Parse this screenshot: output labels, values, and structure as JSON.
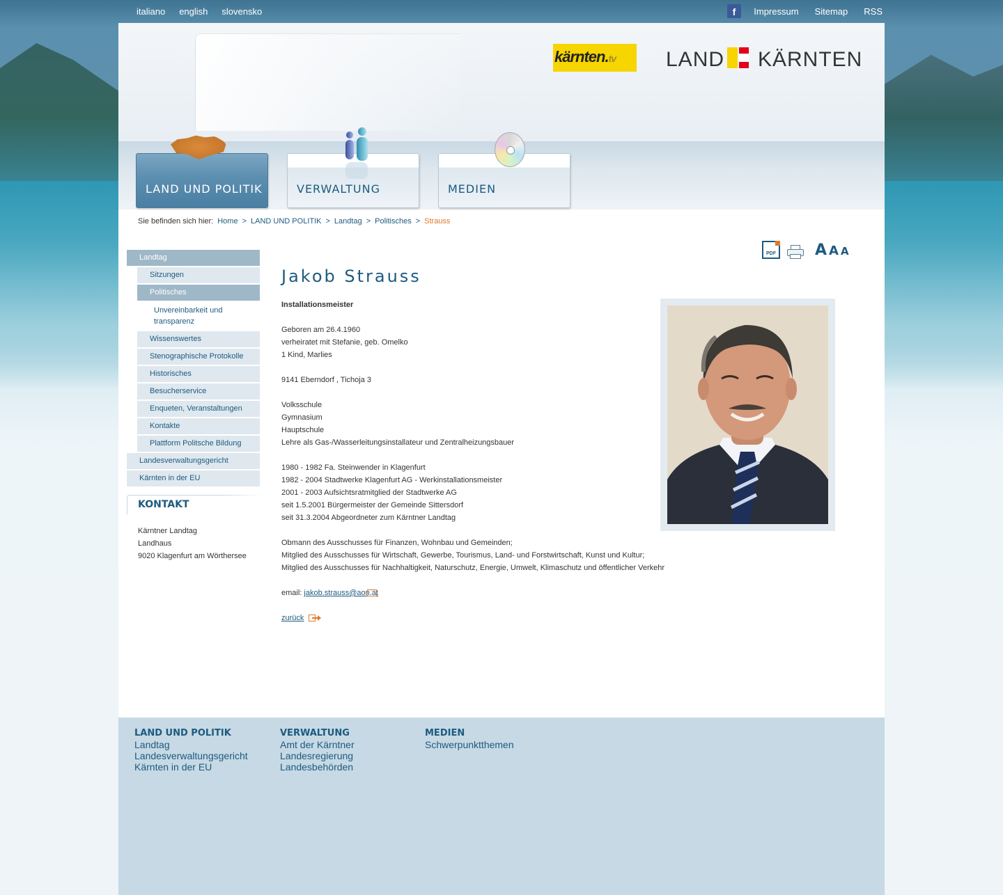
{
  "topbar": {
    "languages": [
      "italiano",
      "english",
      "slovensko"
    ],
    "links": [
      "Impressum",
      "Sitemap",
      "RSS"
    ]
  },
  "header": {
    "ktv_logo": "kärnten.",
    "ktv_logo_suffix": "tv",
    "logo_left": "LAND",
    "logo_right": "KÄRNTEN"
  },
  "nav": {
    "tabs": [
      {
        "label": "LAND UND POLITIK",
        "active": true
      },
      {
        "label": "VERWALTUNG",
        "active": false
      },
      {
        "label": "MEDIEN",
        "active": false
      }
    ]
  },
  "breadcrumb": {
    "prefix": "Sie befinden sich hier:",
    "items": [
      "Home",
      "LAND UND POLITIK",
      "Landtag",
      "Politisches"
    ],
    "current": "Strauss",
    "separator": ">"
  },
  "sidebar": {
    "items": [
      {
        "label": "Landtag"
      },
      {
        "label": "Sitzungen"
      },
      {
        "label": "Politisches"
      },
      {
        "label": "Unvereinbarkeit und transparenz"
      },
      {
        "label": "Wissenswertes"
      },
      {
        "label": "Stenographische Protokolle"
      },
      {
        "label": "Historisches"
      },
      {
        "label": "Besucherservice"
      },
      {
        "label": "Enqueten, Veranstaltungen"
      },
      {
        "label": "Kontakte"
      },
      {
        "label": "Plattform Politsche Bildung"
      },
      {
        "label": "Landesverwaltungsgericht"
      },
      {
        "label": "Kärnten in der EU"
      }
    ]
  },
  "kontakt": {
    "title": "KONTAKT",
    "lines": [
      "Kärntner Landtag",
      "Landhaus",
      "9020 Klagenfurt am Wörthersee"
    ]
  },
  "tools": {
    "pdf": "PDF",
    "font_large": "A",
    "font_medium": "A",
    "font_small": "A"
  },
  "profile": {
    "name": "Jakob Strauss",
    "job": "Installationsmeister",
    "personal": [
      "Geboren am 26.4.1960",
      "verheiratet mit Stefanie, geb. Omelko",
      "1 Kind, Marlies"
    ],
    "address": "9141 Eberndorf , Tichoja 3",
    "education": [
      "Volksschule",
      "Gymnasium",
      "Hauptschule",
      "Lehre als Gas-/Wasserleitungsinstallateur und Zentralheizungsbauer"
    ],
    "career": [
      "1980 - 1982 Fa. Steinwender in Klagenfurt",
      "1982 - 2004 Stadtwerke Klagenfurt AG - Werkinstallationsmeister",
      "2001 - 2003 Aufsichtsratmitglied der Stadtwerke AG",
      "seit 1.5.2001 Bürgermeister der Gemeinde Sittersdorf",
      "seit 31.3.2004 Abgeordneter zum Kärntner Landtag"
    ],
    "committees": [
      "Obmann des Ausschusses für Finanzen, Wohnbau und Gemeinden;",
      "Mitglied des Ausschusses für Wirtschaft, Gewerbe, Tourismus, Land- und Forstwirtschaft, Kunst und Kultur;",
      "Mitglied des Ausschusses für Nachhaltigkeit, Naturschutz, Energie, Umwelt, Klimaschutz und öffentlicher Verkehr"
    ],
    "email_label": "email:",
    "email": "jakob.strauss@aon.at",
    "back": "zurück"
  },
  "footer": {
    "columns": [
      {
        "head": "LAND UND POLITIK",
        "links": [
          "Landtag",
          "Landesverwaltungsgericht",
          "Kärnten in der EU"
        ]
      },
      {
        "head": "VERWALTUNG",
        "links": [
          "Amt der Kärntner",
          "Landesregierung",
          "Landesbehörden"
        ]
      },
      {
        "head": "MEDIEN",
        "links": [
          "Schwerpunktthemen"
        ]
      }
    ]
  },
  "colors": {
    "accent": "#1d5a80",
    "highlight": "#e0782a",
    "nav_active": "#5c8eb0"
  }
}
